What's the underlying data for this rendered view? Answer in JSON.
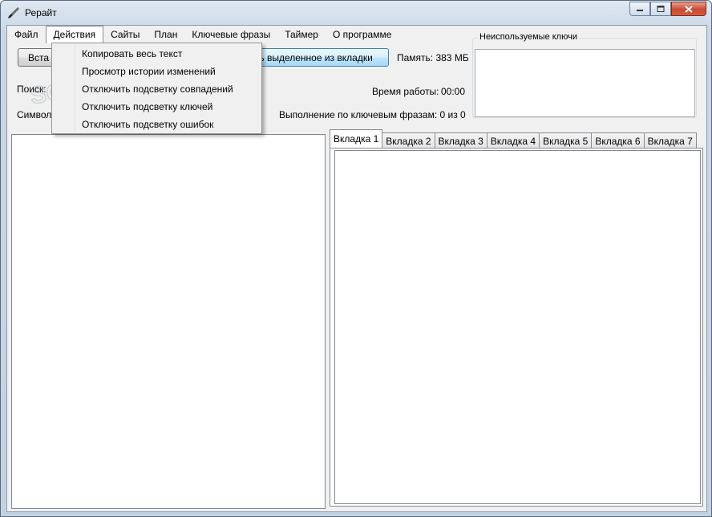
{
  "window": {
    "title": "Рерайт",
    "icon": "brush-icon",
    "controls": {
      "minimize": "minimize-icon",
      "maximize": "maximize-icon",
      "close": "close-icon"
    }
  },
  "menubar": {
    "items": [
      "Файл",
      "Действия",
      "Сайты",
      "План",
      "Ключевые фразы",
      "Таймер",
      "О программе"
    ],
    "open_menu": "Действия"
  },
  "actions_menu": {
    "items": [
      "Копировать весь текст",
      "Просмотр истории изменений",
      "Отключить подсветку совпадений",
      "Отключить подсветку ключей",
      "Отключить подсветку ошибок"
    ]
  },
  "toolbar": {
    "insert_button_label": "Вста",
    "copy_selected_button_label": "вать выделенное из вкладки",
    "memory_label": "Память: 383 МБ",
    "search_label": "Поиск:",
    "work_time_label": "Время работы:",
    "work_time_value": "00:00",
    "symbols_label": "Символо",
    "keyphrases_progress_label": "Выполнение по ключевым фразам: 0 из 0"
  },
  "unused_keys": {
    "title": "Неиспользуемые ключи",
    "items": []
  },
  "tabs": {
    "labels": [
      "Вкладка 1",
      "Вкладка 2",
      "Вкладка 3",
      "Вкладка 4",
      "Вкладка 5",
      "Вкладка 6",
      "Вкладка 7"
    ],
    "active_index": 0
  },
  "editors": {
    "left_text": "",
    "tab_text": ""
  },
  "watermark": {
    "text": "SOFTPORTAL"
  }
}
